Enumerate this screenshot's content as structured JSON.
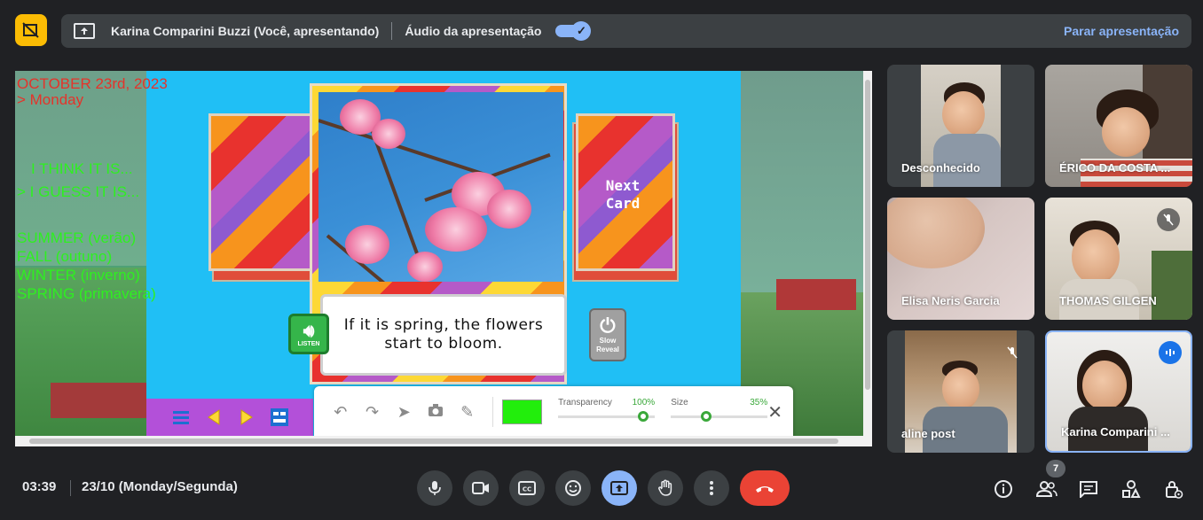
{
  "presenting_bar": {
    "presenter": "Karina Comparini Buzzi (Você, apresentando)",
    "audio_label": "Áudio da apresentação",
    "audio_on": true,
    "stop_label": "Parar apresentação"
  },
  "slide": {
    "date_line1": "OCTOBER 23rd, 2023",
    "date_line2": "> Monday",
    "think_line": "I THINK IT IS...",
    "guess_line": "> I GUESS IT IS...",
    "seasons": [
      "SUMMER (verão)",
      "FALL (outuno)",
      "WINTER (inverno)",
      "SPRING (primavera)"
    ],
    "next_card_label": "Next\nCard",
    "caption": "If it is spring, the flowers start to bloom.",
    "listen_label": "LISTEN",
    "slow_reveal_label": "Slow\nReveal",
    "colors": {
      "text_red": "#e5332a",
      "text_green": "#2ef020",
      "swatch": "#22ee0c"
    }
  },
  "draw_toolbar": {
    "transparency_label": "Transparency",
    "transparency_value": "100%",
    "transparency_fraction": 1.0,
    "size_label": "Size",
    "size_value": "35%",
    "size_fraction": 0.35
  },
  "participants": [
    {
      "name": "Desconhecido",
      "muted": false
    },
    {
      "name": "ÉRICO DA COSTA ...",
      "muted": false
    },
    {
      "name": "Elisa Neris Garcia",
      "muted": false
    },
    {
      "name": "THOMAS GILGEN",
      "muted": true
    },
    {
      "name": "aline post",
      "muted": true
    },
    {
      "name": "Karina Comparini ...",
      "muted": false,
      "speaking": true
    }
  ],
  "bottom_bar": {
    "time": "03:39",
    "meeting": "23/10 (Monday/Segunda)",
    "participant_count": "7"
  }
}
